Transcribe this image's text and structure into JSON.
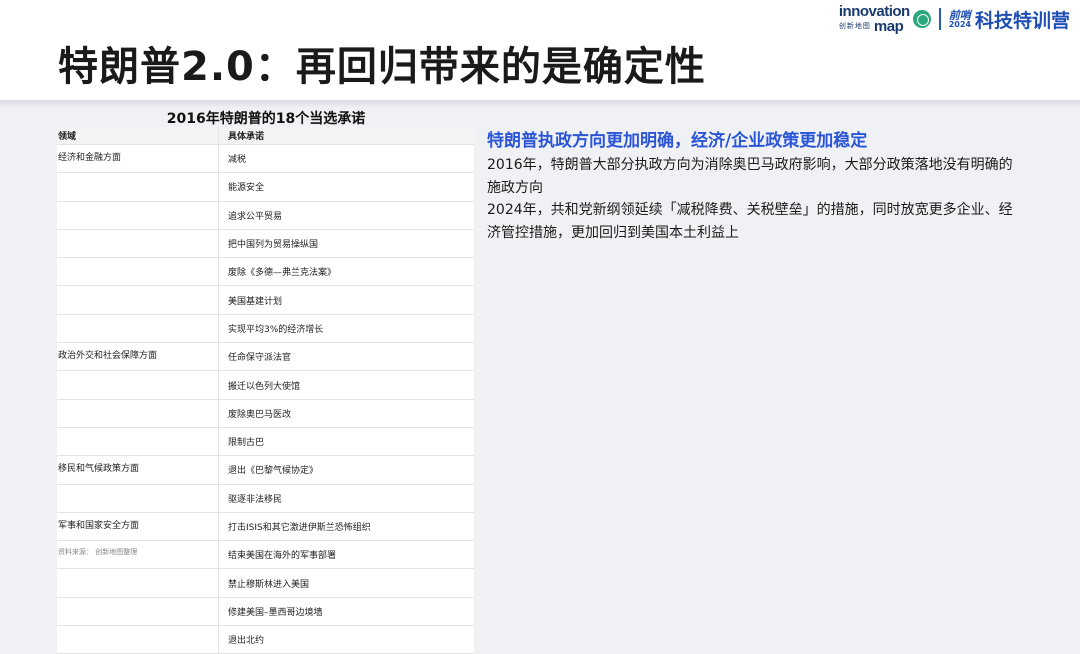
{
  "slide": {
    "title": "特朗普2.0：再回归带来的是确定性",
    "logo": {
      "brand_line1": "innovation",
      "brand_line2": "创新地图",
      "brand_line1b": "map",
      "event_prefix": "前哨",
      "event_year": "2024",
      "event_name": "科技特训营"
    }
  },
  "table": {
    "caption": "2016年特朗普的18个当选承诺",
    "headers": [
      "领域",
      "具体承诺"
    ],
    "rows": [
      [
        "经济和金融方面",
        "减税"
      ],
      [
        "",
        "能源安全"
      ],
      [
        "",
        "追求公平贸易"
      ],
      [
        "",
        "把中国列为贸易操纵国"
      ],
      [
        "",
        "废除《多德—弗兰克法案》"
      ],
      [
        "",
        "美国基建计划"
      ],
      [
        "",
        "实现平均3%的经济增长"
      ],
      [
        "政治外交和社会保障方面",
        "任命保守派法官"
      ],
      [
        "",
        "搬迁以色列大使馆"
      ],
      [
        "",
        "废除奥巴马医改"
      ],
      [
        "",
        "限制古巴"
      ],
      [
        "移民和气候政策方面",
        "退出《巴黎气候协定》"
      ],
      [
        "",
        "驱逐非法移民"
      ],
      [
        "军事和国家安全方面",
        "打击ISIS和其它激进伊斯兰恐怖组织"
      ],
      [
        "",
        "结束美国在海外的军事部署"
      ],
      [
        "",
        "禁止穆斯林进入美国"
      ],
      [
        "",
        "修建美国–墨西哥边境墙"
      ],
      [
        "",
        "退出北约"
      ]
    ],
    "source": "资料来源： 创新地图整理"
  },
  "right": {
    "heading": "特朗普执政方向更加明确，经济/企业政策更加稳定",
    "paragraphs": [
      "2016年，特朗普大部分执政方向为消除奥巴马政府影响，大部分政策落地没有明确的施政方向",
      "2024年，共和党新纲领延续「减税降费、关税壁垒」的措施，同时放宽更多企业、经济管控措施，更加回归到美国本土利益上"
    ]
  },
  "colors": {
    "accent": "#2a55d6",
    "background": "#f0f1f5"
  }
}
